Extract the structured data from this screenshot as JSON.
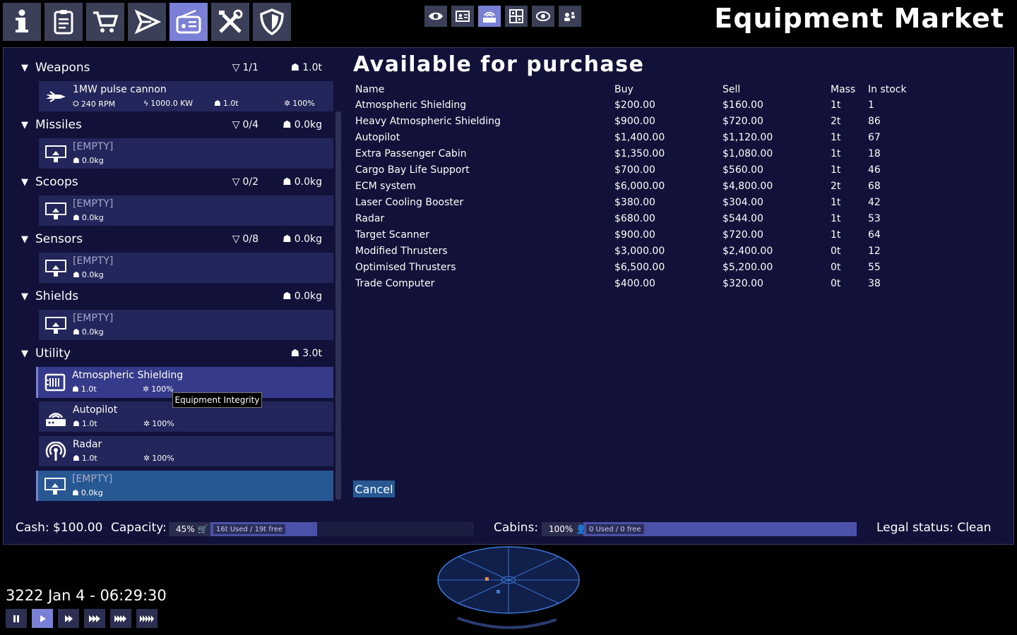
{
  "screen_title": "Equipment Market",
  "top_nav": [
    "info-icon",
    "clipboard-icon",
    "cart-icon",
    "ship-icon",
    "radio-icon",
    "tools-icon",
    "shield-icon"
  ],
  "sub_nav": [
    "eye-icon",
    "id-card-icon",
    "autopilot-icon",
    "hull-icon",
    "orbit-icon",
    "crew-icon"
  ],
  "groups": [
    {
      "name": "Weapons",
      "slots": "1/1",
      "mass": "1.0t"
    },
    {
      "name": "Missiles",
      "slots": "0/4",
      "mass": "0.0kg"
    },
    {
      "name": "Scoops",
      "slots": "0/2",
      "mass": "0.0kg"
    },
    {
      "name": "Sensors",
      "slots": "0/8",
      "mass": "0.0kg"
    },
    {
      "name": "Shields",
      "slots": "",
      "mass": "0.0kg"
    },
    {
      "name": "Utility",
      "slots": "",
      "mass": "3.0t"
    }
  ],
  "slots": [
    {
      "name": "1MW pulse cannon",
      "rpm": "240 RPM",
      "power": "1000.0 KW",
      "mass": "1.0t",
      "integrity": "100%"
    },
    {
      "name": "[EMPTY]",
      "mass": "0.0kg"
    },
    {
      "name": "[EMPTY]",
      "mass": "0.0kg"
    },
    {
      "name": "[EMPTY]",
      "mass": "0.0kg"
    },
    {
      "name": "[EMPTY]",
      "mass": "0.0kg"
    },
    {
      "name": "Atmospheric Shielding",
      "mass": "1.0t",
      "integrity": "100%"
    },
    {
      "name": "Autopilot",
      "mass": "1.0t",
      "integrity": "100%"
    },
    {
      "name": "Radar",
      "mass": "1.0t",
      "integrity": "100%"
    },
    {
      "name": "[EMPTY]",
      "mass": "0.0kg"
    }
  ],
  "tooltip": "Equipment Integrity",
  "market": {
    "title": "Available for purchase",
    "headers": [
      "Name",
      "Buy",
      "Sell",
      "Mass",
      "In stock"
    ],
    "rows": [
      [
        "Atmospheric Shielding",
        "$200.00",
        "$160.00",
        "1t",
        "1"
      ],
      [
        "Heavy Atmospheric Shielding",
        "$900.00",
        "$720.00",
        "2t",
        "86"
      ],
      [
        "Autopilot",
        "$1,400.00",
        "$1,120.00",
        "1t",
        "67"
      ],
      [
        "Extra Passenger Cabin",
        "$1,350.00",
        "$1,080.00",
        "1t",
        "18"
      ],
      [
        "Cargo Bay Life Support",
        "$700.00",
        "$560.00",
        "1t",
        "46"
      ],
      [
        "ECM system",
        "$6,000.00",
        "$4,800.00",
        "2t",
        "68"
      ],
      [
        "Laser Cooling Booster",
        "$380.00",
        "$304.00",
        "1t",
        "42"
      ],
      [
        "Radar",
        "$680.00",
        "$544.00",
        "1t",
        "53"
      ],
      [
        "Target Scanner",
        "$900.00",
        "$720.00",
        "1t",
        "64"
      ],
      [
        "Modified Thrusters",
        "$3,000.00",
        "$2,400.00",
        "0t",
        "12"
      ],
      [
        "Optimised Thrusters",
        "$6,500.00",
        "$5,200.00",
        "0t",
        "55"
      ],
      [
        "Trade Computer",
        "$400.00",
        "$320.00",
        "0t",
        "38"
      ]
    ],
    "cancel": "Cancel"
  },
  "footer": {
    "cash": "Cash: $100.00",
    "capacity_label": "Capacity:",
    "capacity_pct": "45%",
    "capacity_fraction": 0.45,
    "capacity_text": "16t Used / 19t free",
    "cabins_label": "Cabins:",
    "cabins_pct": "100%",
    "cabins_fraction": 1.0,
    "cabins_text": "0 Used / 0 free",
    "legal": "Legal status: Clean"
  },
  "datetime": "3222 Jan 4 - 06:29:30",
  "time_controls": [
    "pause-icon",
    "play-icon",
    "fast-1-icon",
    "fast-2-icon",
    "fast-3-icon",
    "fast-4-icon"
  ],
  "colors": {
    "panel": "#11113a",
    "slot": "#22265a",
    "accent": "#7a80d6",
    "selected": "#285894"
  }
}
